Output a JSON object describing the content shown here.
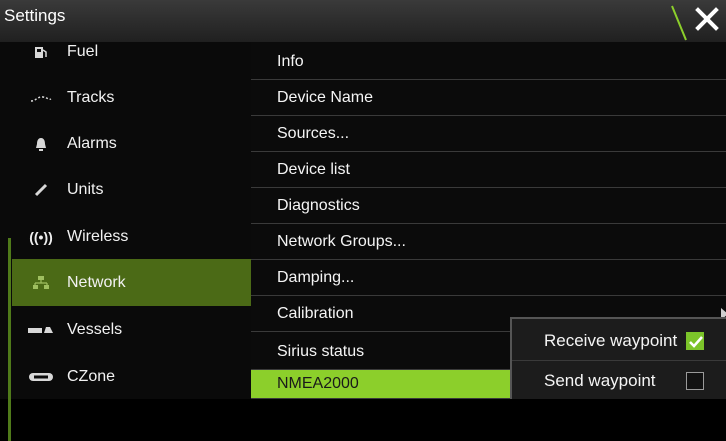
{
  "window": {
    "title": "Settings",
    "close_icon": "close-icon"
  },
  "colors": {
    "accent": "#8ccf2b",
    "selected_bg": "#4b6a16"
  },
  "sidebar": {
    "items": [
      {
        "label": "Fuel",
        "icon": "fuel-icon"
      },
      {
        "label": "Tracks",
        "icon": "tracks-icon"
      },
      {
        "label": "Alarms",
        "icon": "bell-icon"
      },
      {
        "label": "Units",
        "icon": "units-icon"
      },
      {
        "label": "Wireless",
        "icon": "wireless-icon"
      },
      {
        "label": "Network",
        "icon": "network-icon",
        "selected": true
      },
      {
        "label": "Vessels",
        "icon": "vessels-icon"
      },
      {
        "label": "CZone",
        "icon": "czone-icon"
      }
    ],
    "wireless_glyph": "((•))"
  },
  "menu": {
    "items": [
      {
        "label": "Info"
      },
      {
        "label": "Device Name"
      },
      {
        "label": "Sources..."
      },
      {
        "label": "Device list"
      },
      {
        "label": "Diagnostics"
      },
      {
        "label": "Network Groups..."
      },
      {
        "label": "Damping..."
      },
      {
        "label": "Calibration"
      },
      {
        "label": "Sirius status"
      },
      {
        "label": "NMEA2000",
        "active": true
      }
    ]
  },
  "popup": {
    "rows": [
      {
        "label": "Receive waypoint",
        "checked": true
      },
      {
        "label": "Send waypoint",
        "checked": false
      }
    ]
  }
}
